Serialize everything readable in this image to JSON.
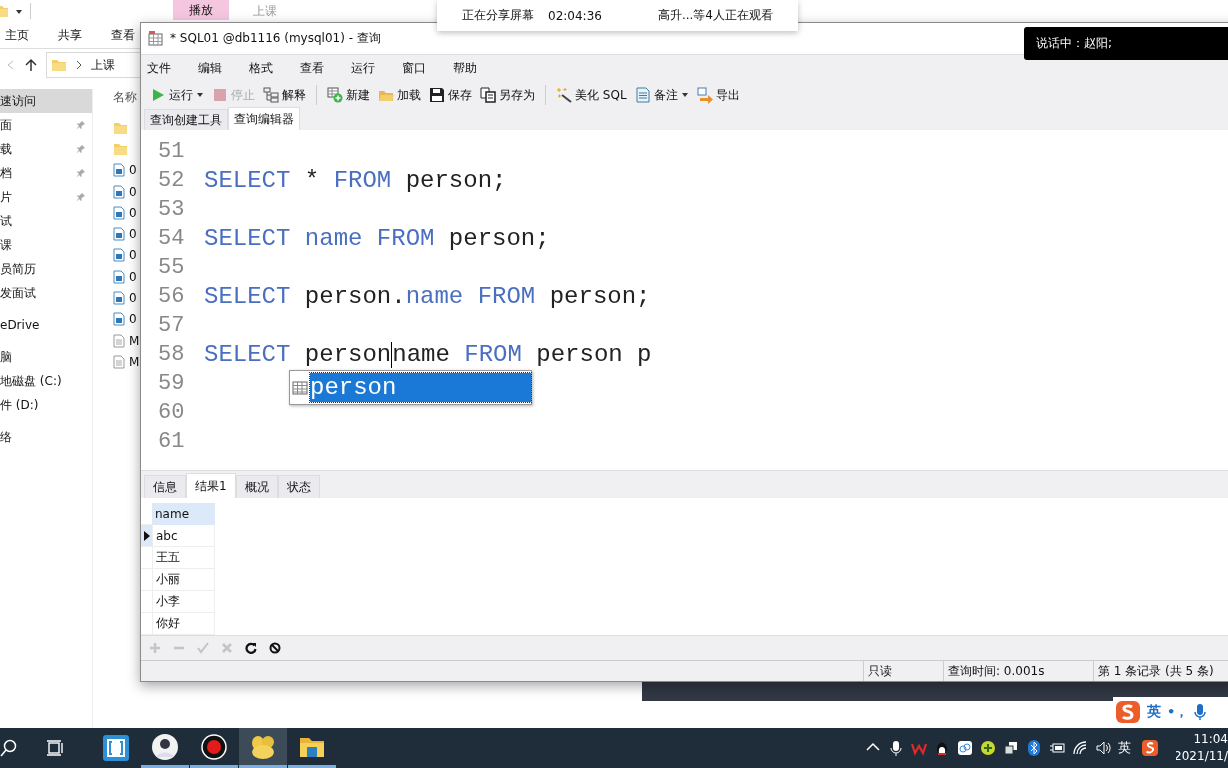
{
  "explorer": {
    "title_tabs": [
      {
        "label": "播放",
        "kind": "context"
      },
      {
        "label": "上课",
        "kind": "title"
      }
    ],
    "ribbon_tabs": [
      "主页",
      "共享",
      "查看"
    ],
    "address": {
      "path": "上课"
    },
    "nav_items": [
      {
        "label": "速访问",
        "kind": "root",
        "selected": true,
        "pinned": false
      },
      {
        "label": "面",
        "kind": "item",
        "selected": false,
        "pinned": true
      },
      {
        "label": "载",
        "kind": "item",
        "selected": false,
        "pinned": true
      },
      {
        "label": "档",
        "kind": "item",
        "selected": false,
        "pinned": true
      },
      {
        "label": "片",
        "kind": "item",
        "selected": false,
        "pinned": true
      },
      {
        "label": "试",
        "kind": "item",
        "selected": false,
        "pinned": false
      },
      {
        "label": "课",
        "kind": "item",
        "selected": false,
        "pinned": false
      },
      {
        "label": "员简历",
        "kind": "item",
        "selected": false,
        "pinned": false
      },
      {
        "label": "发面试",
        "kind": "item",
        "selected": false,
        "pinned": false
      },
      {
        "label": "eDrive",
        "kind": "root",
        "selected": false,
        "pinned": false
      },
      {
        "label": "脑",
        "kind": "root",
        "selected": false,
        "pinned": false
      },
      {
        "label": "地磁盘 (C:)",
        "kind": "item",
        "selected": false,
        "pinned": false
      },
      {
        "label": "件 (D:)",
        "kind": "item",
        "selected": false,
        "pinned": false
      },
      {
        "label": "络",
        "kind": "root",
        "selected": false,
        "pinned": false
      }
    ],
    "name_column": "名称",
    "files": [
      {
        "kind": "folder"
      },
      {
        "kind": "folder"
      },
      {
        "kind": "video",
        "name": "0"
      },
      {
        "kind": "video",
        "name": "0"
      },
      {
        "kind": "video",
        "name": "0"
      },
      {
        "kind": "video",
        "name": "0"
      },
      {
        "kind": "video",
        "name": "0"
      },
      {
        "kind": "video",
        "name": "0"
      },
      {
        "kind": "video",
        "name": "0"
      },
      {
        "kind": "video",
        "name": "0"
      },
      {
        "kind": "doc",
        "name": "M"
      },
      {
        "kind": "doc",
        "name": "M"
      }
    ]
  },
  "share_banner": {
    "status": "正在分享屏幕",
    "elapsed": "02:04:36",
    "viewers": "高升...等4人正在观看"
  },
  "speaking_toast": {
    "text": "说话中：赵阳;"
  },
  "query_window": {
    "title": "* SQL01 @db1116 (mysql01) - 查询",
    "menu": [
      "文件",
      "编辑",
      "格式",
      "查看",
      "运行",
      "窗口",
      "帮助"
    ],
    "toolbar": [
      [
        {
          "label": "运行",
          "dropdown": true,
          "disabled": false
        },
        {
          "label": "停止",
          "dropdown": false,
          "disabled": true
        },
        {
          "label": "解释",
          "dropdown": false,
          "disabled": false
        }
      ],
      [
        {
          "label": "新建",
          "dropdown": false,
          "disabled": false
        },
        {
          "label": "加载",
          "dropdown": false,
          "disabled": false
        },
        {
          "label": "保存",
          "dropdown": false,
          "disabled": false
        },
        {
          "label": "另存为",
          "dropdown": false,
          "disabled": false
        }
      ],
      [
        {
          "label": "美化 SQL",
          "dropdown": false,
          "disabled": false
        },
        {
          "label": "备注",
          "dropdown": true,
          "disabled": false
        },
        {
          "label": "导出",
          "dropdown": false,
          "disabled": false
        }
      ]
    ],
    "editor_tabs": [
      {
        "label": "查询创建工具",
        "selected": false
      },
      {
        "label": "查询编辑器",
        "selected": true
      }
    ],
    "lines": [
      {
        "number": "51"
      },
      {
        "number": "52",
        "tokens": [
          {
            "kind": "keyword",
            "text": "SELECT"
          },
          {
            "kind": "text",
            "text": " * "
          },
          {
            "kind": "keyword",
            "text": "FROM"
          },
          {
            "kind": "text",
            "text": " person;"
          }
        ]
      },
      {
        "number": "53"
      },
      {
        "number": "54",
        "tokens": [
          {
            "kind": "keyword",
            "text": "SELECT"
          },
          {
            "kind": "keyword",
            "text": " name"
          },
          {
            "kind": "keyword",
            "text": " FROM"
          },
          {
            "kind": "text",
            "text": " person;"
          }
        ]
      },
      {
        "number": "55"
      },
      {
        "number": "56",
        "tokens": [
          {
            "kind": "keyword",
            "text": "SELECT"
          },
          {
            "kind": "text",
            "text": " person."
          },
          {
            "kind": "keyword",
            "text": "name"
          },
          {
            "kind": "keyword",
            "text": " FROM"
          },
          {
            "kind": "text",
            "text": " person;"
          }
        ]
      },
      {
        "number": "57"
      },
      {
        "number": "58",
        "tokens": [
          {
            "kind": "keyword",
            "text": "SELECT"
          },
          {
            "kind": "text",
            "text": " person"
          },
          {
            "kind": "cursor"
          },
          {
            "kind": "text",
            "text": "name"
          },
          {
            "kind": "keyword",
            "text": " FROM"
          },
          {
            "kind": "text",
            "text": " person p"
          }
        ]
      },
      {
        "number": "59"
      },
      {
        "number": "60"
      },
      {
        "number": "61"
      }
    ],
    "autocomplete": [
      {
        "text": "person",
        "selected": true
      }
    ],
    "result_tabs": [
      {
        "label": "信息",
        "selected": false
      },
      {
        "label": "结果1",
        "selected": true
      },
      {
        "label": "概况",
        "selected": false
      },
      {
        "label": "状态",
        "selected": false
      }
    ],
    "grid": {
      "columns": [
        "name"
      ],
      "rows": [
        {
          "cells": [
            "abc"
          ],
          "current": true
        },
        {
          "cells": [
            "王五"
          ],
          "current": false
        },
        {
          "cells": [
            "小丽"
          ],
          "current": false
        },
        {
          "cells": [
            "小李"
          ],
          "current": false
        },
        {
          "cells": [
            "你好"
          ],
          "current": false
        }
      ]
    },
    "grid_tools": [
      {
        "disabled": true
      },
      {
        "disabled": true
      },
      {
        "disabled": true
      },
      {
        "disabled": true
      },
      {
        "disabled": false
      },
      {
        "disabled": false
      }
    ],
    "status_bar": [
      "只读",
      "查询时间: 0.001s",
      "第 1 条记录 (共 5 条)"
    ]
  },
  "ime_bar": {
    "mode": "英",
    "punctuation": "•，"
  },
  "taskbar": {
    "apps": [
      {
        "running": false,
        "active": false
      },
      {
        "running": true,
        "active": false
      },
      {
        "running": true,
        "active": false
      },
      {
        "running": true,
        "active": true
      },
      {
        "running": true,
        "active": false
      }
    ],
    "language": "英",
    "time": "11:04",
    "date": "2021/11/"
  }
}
